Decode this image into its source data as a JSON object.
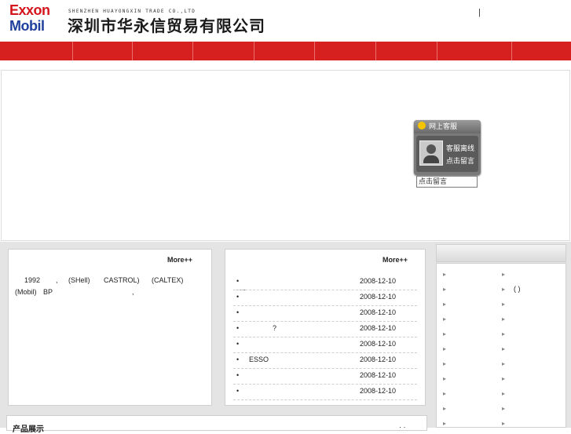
{
  "header": {
    "logo_line1": "Exxon",
    "logo_line2": "Mobil",
    "company_en": "SHENZHEN HUAYONGXIN TRADE CO.,LTD",
    "company_cn": "深圳市华永信贸易有限公司",
    "separator": "|"
  },
  "nav": {
    "item_count": 9
  },
  "service": {
    "title": "网上客服",
    "status": "客服离线",
    "leave_message": "点击留言",
    "input_value": "点击留言"
  },
  "about": {
    "more": "More++",
    "line1": [
      "1992",
      ",",
      "(SHell)",
      "CASTROL)",
      "(CALTEX)"
    ],
    "line2": [
      "(Mobil)",
      "BP",
      ","
    ]
  },
  "news": {
    "more": "More++",
    "items": [
      {
        "bullet": "•",
        "title": "",
        "date": "2008-12-10"
      },
      {
        "bullet": "•",
        "title": "",
        "date": "2008-12-10"
      },
      {
        "bullet": "•",
        "title": "",
        "date": "2008-12-10"
      },
      {
        "bullet": "•",
        "title": "?",
        "date": "2008-12-10"
      },
      {
        "bullet": "•",
        "title": "",
        "date": "2008-12-10"
      },
      {
        "bullet": "•",
        "title": "ESSO",
        "date": "2008-12-10"
      },
      {
        "bullet": "•",
        "title": "",
        "date": "2008-12-10"
      },
      {
        "bullet": "•",
        "title": "",
        "date": "2008-12-10"
      }
    ]
  },
  "sidebar": {
    "arrow": "▸",
    "extra_text": "( )"
  },
  "products": {
    "title": "产品展示",
    "more": "· ·"
  }
}
